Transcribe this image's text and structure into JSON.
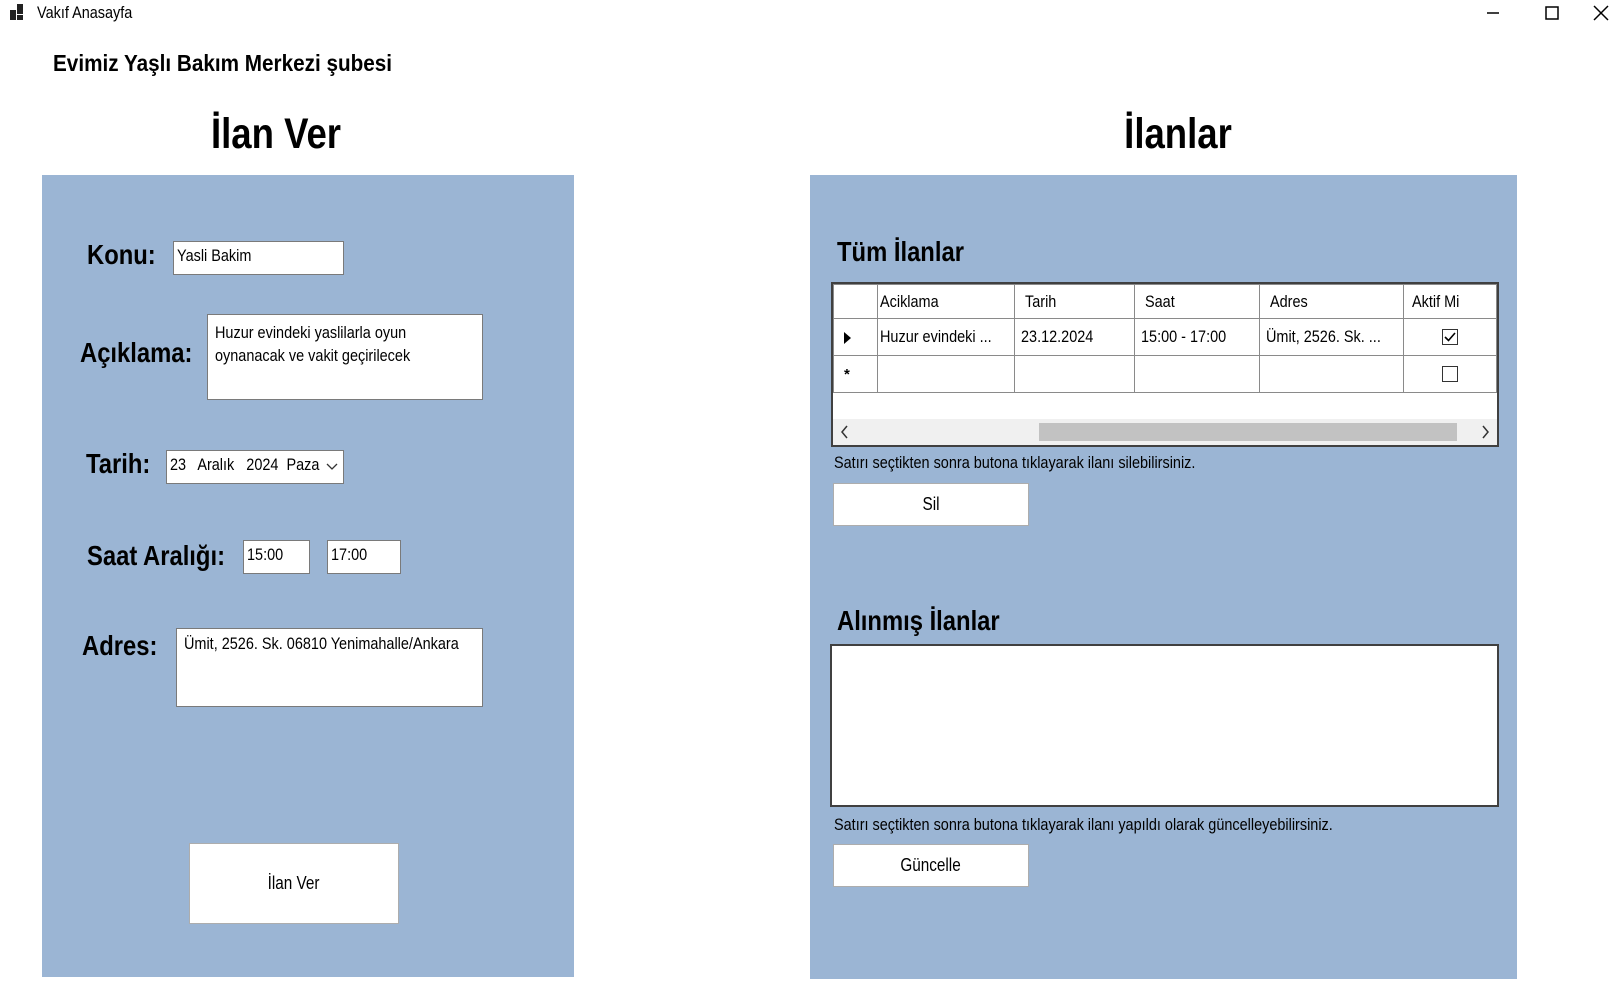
{
  "window": {
    "title": "Vakıf Anasayfa",
    "controls": [
      "minimize",
      "maximize",
      "close"
    ]
  },
  "branch_name": "Evimiz Yaşlı Bakım Merkezi şubesi",
  "left_panel": {
    "title": "İlan Ver",
    "konu_label": "Konu:",
    "konu_value": "Yasli Bakim",
    "aciklama_label": "Açıklama:",
    "aciklama_value": "Huzur evindeki yaslilarla oyun oynanacak ve vakit geçirilecek",
    "tarih_label": "Tarih:",
    "tarih_value": "23   Aralık   2024  Paza",
    "saat_label": "Saat Aralığı:",
    "saat_start": "15:00",
    "saat_end": "17:00",
    "adres_label": "Adres:",
    "adres_value": "Ümit, 2526. Sk. 06810 Yenimahalle/Ankara",
    "submit_label": "İlan Ver"
  },
  "right_panel": {
    "title": "İlanlar",
    "tum_ilanlar_label": "Tüm İlanlar",
    "grid": {
      "columns": [
        "Aciklama",
        "Tarih",
        "Saat",
        "Adres",
        "Aktif Mi"
      ],
      "rows": [
        {
          "aciklama": "Huzur evindeki ...",
          "tarih": "23.12.2024",
          "saat": "15:00 - 17:00",
          "adres": "Ümit, 2526. Sk. ...",
          "aktif": true
        }
      ],
      "new_row_marker": "*"
    },
    "sil_hint": "Satırı seçtikten sonra butona tıklayarak ilanı silebilirsiniz.",
    "sil_label": "Sil",
    "alinmis_label": "Alınmış İlanlar",
    "guncelle_hint": "Satırı seçtikten sonra butona tıklayarak ilanı yapıldı olarak güncelleyebilirsiniz.",
    "guncelle_label": "Güncelle"
  },
  "colors": {
    "panel": "#9bb5d4",
    "background": "#ffffff"
  }
}
